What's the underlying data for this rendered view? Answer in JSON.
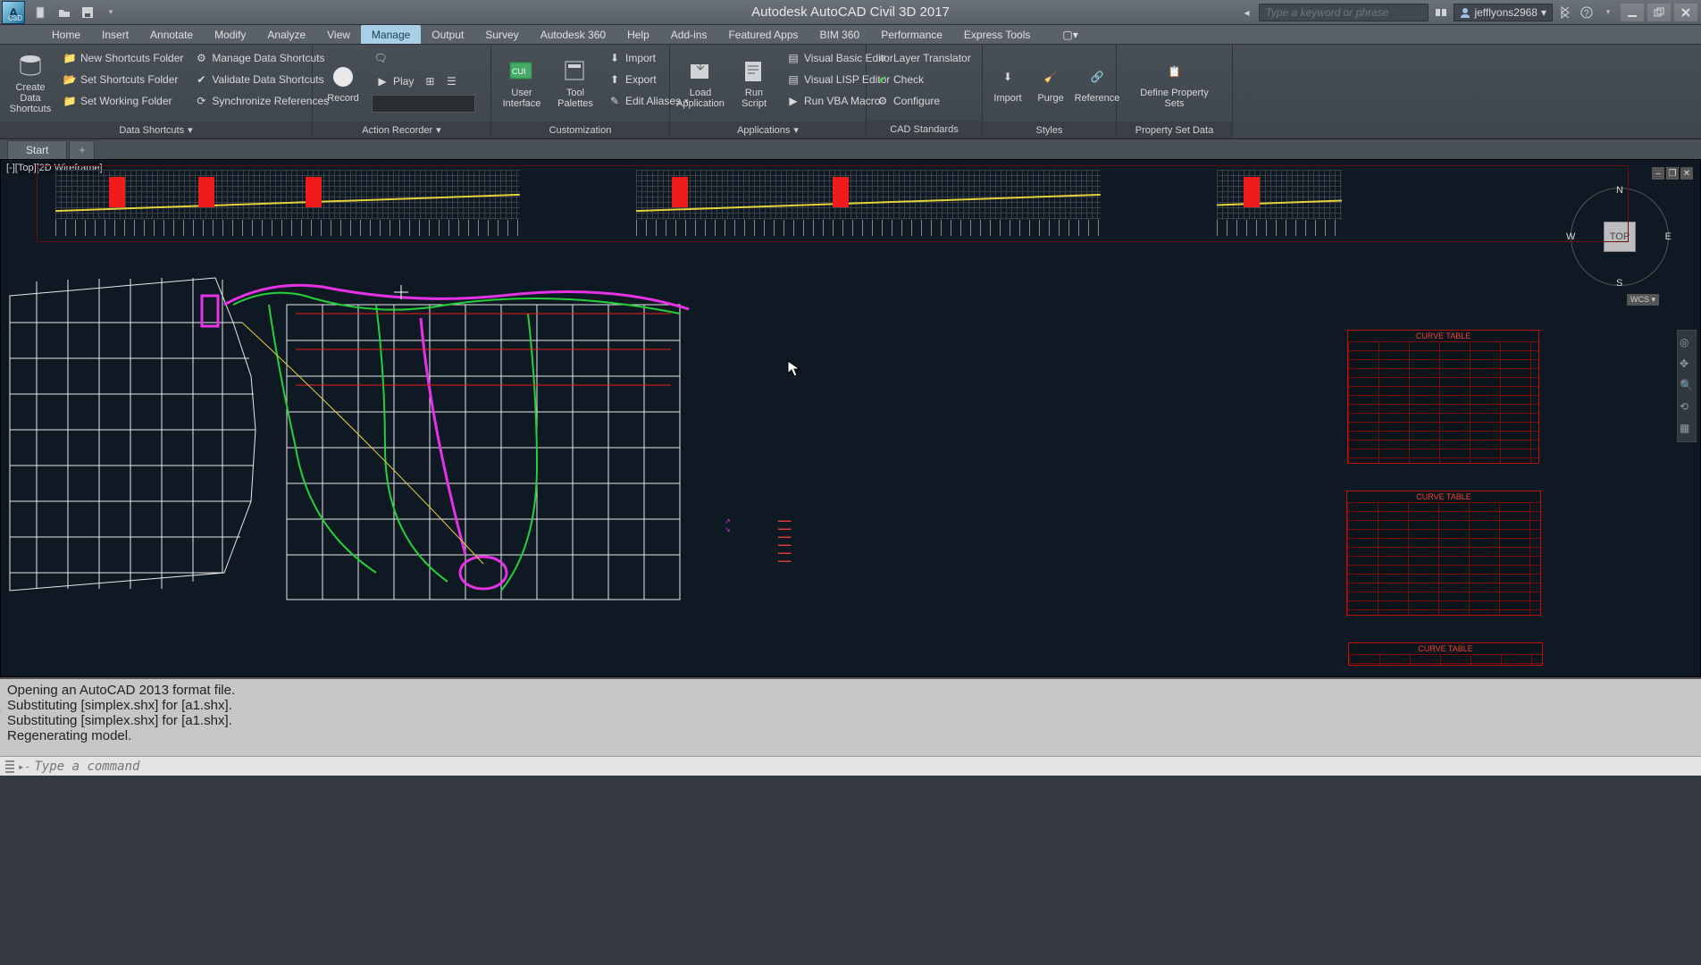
{
  "title_bar": {
    "app_title": "Autodesk AutoCAD Civil 3D 2017",
    "app_icon_letter": "A",
    "app_icon_sub": "C3D",
    "search_placeholder": "Type a keyword or phrase",
    "user": "jefflyons2968",
    "qat_drop": "▾"
  },
  "tabs": {
    "items": [
      "Home",
      "Insert",
      "Annotate",
      "Modify",
      "Analyze",
      "View",
      "Manage",
      "Output",
      "Survey",
      "Autodesk 360",
      "Help",
      "Add-ins",
      "Featured Apps",
      "BIM 360",
      "Performance",
      "Express Tools"
    ],
    "active_index": 6
  },
  "ribbon": {
    "panels": [
      {
        "title": "Data Shortcuts",
        "big": [
          {
            "label": "Create Data\nShortcuts"
          }
        ],
        "rows": [
          [
            "New Shortcuts Folder",
            "Manage Data Shortcuts"
          ],
          [
            "Set Shortcuts Folder",
            "Validate Data Shortcuts"
          ],
          [
            "Set Working Folder",
            "Synchronize References"
          ]
        ],
        "has_caret": true
      },
      {
        "title": "Action Recorder",
        "big": [
          {
            "label": "Record"
          }
        ],
        "rows": [
          [
            "Play",
            "",
            ""
          ]
        ],
        "has_combo": true,
        "has_caret": true,
        "play_label": "Play"
      },
      {
        "title": "Customization",
        "big": [
          {
            "label": "User\nInterface"
          },
          {
            "label": "Tool\nPalettes"
          }
        ],
        "rows": [
          [
            "Import"
          ],
          [
            "Export"
          ],
          [
            "Edit Aliases"
          ]
        ],
        "aliases_caret": true
      },
      {
        "title": "Applications",
        "big": [
          {
            "label": "Load\nApplication"
          },
          {
            "label": "Run\nScript"
          }
        ],
        "rows": [
          [
            "Visual Basic Editor"
          ],
          [
            "Visual LISP Editor"
          ],
          [
            "Run VBA Macro"
          ]
        ],
        "has_caret": true
      },
      {
        "title": "CAD Standards",
        "rows": [
          [
            "Layer Translator"
          ],
          [
            "Check"
          ],
          [
            "Configure"
          ]
        ]
      },
      {
        "title": "Styles",
        "big": [
          {
            "label": "Import"
          },
          {
            "label": "Purge"
          },
          {
            "label": "Reference"
          }
        ]
      },
      {
        "title": "Property Set Data",
        "big": [
          {
            "label": "Define Property Sets"
          }
        ]
      }
    ]
  },
  "file_tabs": {
    "start": "Start",
    "plus": "+"
  },
  "viewport": {
    "label": "[-][Top][2D Wireframe]",
    "cube_face": "TOP",
    "n": "N",
    "e": "E",
    "s": "S",
    "w": "W",
    "wcs": "WCS",
    "table_heading": "CURVE TABLE"
  },
  "command_window": {
    "history": "Opening an AutoCAD 2013 format file.\nSubstituting [simplex.shx] for [a1.shx].\nSubstituting [simplex.shx] for [a1.shx].\nRegenerating model.",
    "prompt_placeholder": "Type a command",
    "prompt_prefix": "▸-"
  }
}
